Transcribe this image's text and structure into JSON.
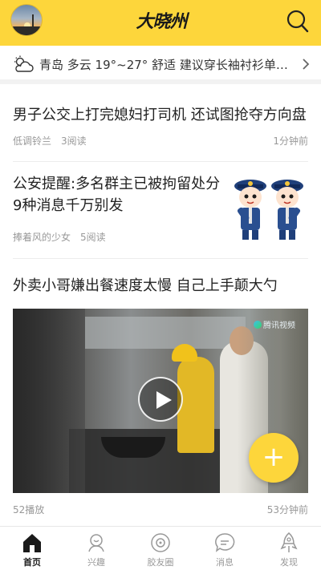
{
  "header": {
    "logo_text": "大晓州",
    "accent_color": "#fdd63b"
  },
  "weather": {
    "text": "青岛 多云 19°~27° 舒适 建议穿长袖衬衫单裤等..."
  },
  "articles": [
    {
      "title": "男子公交上打完媳妇打司机 还试图抢夺方向盘",
      "author": "低调铃兰",
      "reads": "3阅读",
      "time": "1分钟前"
    },
    {
      "title": "公安提醒:多名群主已被拘留处分 9种消息千万别发",
      "author": "捧着风的少女",
      "reads": "5阅读",
      "thumbnail": "police-cartoon"
    },
    {
      "title": "外卖小哥嫌出餐速度太慢 自己上手颠大勺",
      "video_source": "腾讯视频",
      "plays": "52播放",
      "time": "53分钟前"
    }
  ],
  "fab": {
    "label": "+"
  },
  "bottom_nav": [
    {
      "label": "首页",
      "icon": "home-icon",
      "active": true
    },
    {
      "label": "兴趣",
      "icon": "interest-icon",
      "active": false
    },
    {
      "label": "胶友圈",
      "icon": "circle-icon",
      "active": false
    },
    {
      "label": "消息",
      "icon": "message-icon",
      "active": false
    },
    {
      "label": "发现",
      "icon": "discover-icon",
      "active": false
    }
  ]
}
